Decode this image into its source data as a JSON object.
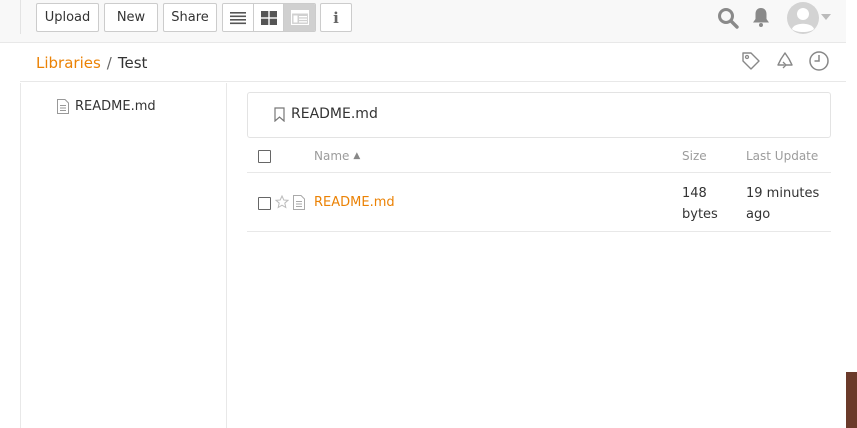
{
  "toolbar": {
    "upload_label": "Upload",
    "new_label": "New",
    "share_label": "Share",
    "view_modes": [
      "list-view-icon",
      "grid-view-icon",
      "column-view-icon"
    ],
    "active_view": "column-view-icon",
    "info_label": "i"
  },
  "breadcrumb": {
    "root": "Libraries",
    "separator": "/",
    "current": "Test"
  },
  "tree": {
    "items": [
      {
        "label": "README.md"
      }
    ]
  },
  "file_header": {
    "title": "README.md"
  },
  "table": {
    "headers": {
      "name": "Name",
      "size": "Size",
      "updated": "Last Update"
    },
    "sort_indicator": "▲",
    "rows": [
      {
        "name": "README.md",
        "size": "148 bytes",
        "updated": "19 minutes ago"
      }
    ]
  },
  "colors": {
    "accent": "#eb8205",
    "muted": "#9c9c9c",
    "border": "#e8e8e8"
  }
}
